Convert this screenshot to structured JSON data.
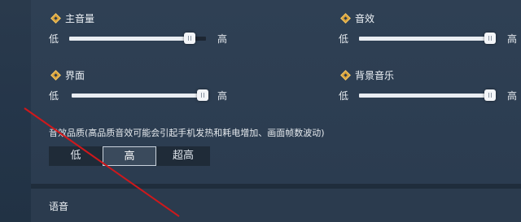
{
  "audio": {
    "master": {
      "label": "主音量",
      "low": "低",
      "high": "高",
      "level_percent": 88
    },
    "effects": {
      "label": "音效",
      "low": "低",
      "high": "高",
      "level_percent": 100
    },
    "interface": {
      "label": "界面",
      "low": "低",
      "high": "高",
      "level_percent": 100
    },
    "music": {
      "label": "背景音乐",
      "low": "低",
      "high": "高",
      "level_percent": 100
    }
  },
  "quality": {
    "title": "音效品质(高品质音效可能会引起手机发热和耗电增加、画面帧数波动)",
    "options": [
      "低",
      "高",
      "超高"
    ],
    "selected": "高"
  },
  "voice": {
    "label": "语音"
  },
  "colors": {
    "accent": "#d9a23a",
    "overlay_line": "#d0181b"
  },
  "icons": {
    "section": "diamond-icon"
  }
}
